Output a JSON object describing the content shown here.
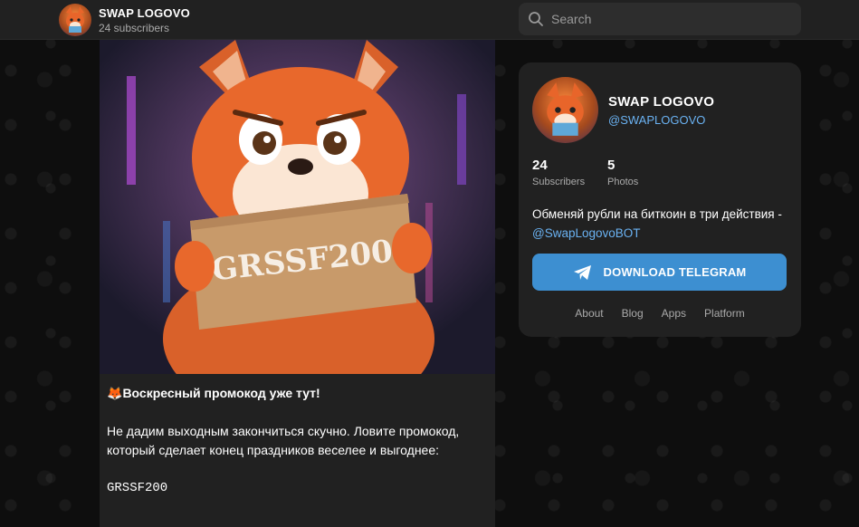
{
  "header": {
    "channel_title": "SWAP LOGOVO",
    "subscribers_text": "24 subscribers",
    "search_placeholder": "Search"
  },
  "post": {
    "image_sign_text": "GRSSF200",
    "headline_emoji": "🦊",
    "headline": "Воскресный промокод уже тут!",
    "body": "Не дадим выходным закончиться скучно. Ловите промокод, который сделает конец праздников веселее и выгоднее:",
    "code": "GRSSF200"
  },
  "card": {
    "name": "SWAP LOGOVO",
    "handle": "@SWAPLOGOVO",
    "stats": [
      {
        "value": "24",
        "label": "Subscribers"
      },
      {
        "value": "5",
        "label": "Photos"
      }
    ],
    "description_prefix": "Обменяй рубли на биткоин в три действия - ",
    "description_link": "@SwapLogovoBOT",
    "download_label": "DOWNLOAD TELEGRAM",
    "footer_links": [
      "About",
      "Blog",
      "Apps",
      "Platform"
    ]
  },
  "colors": {
    "accent_button": "#3d8fd1",
    "link": "#6ab2f2",
    "panel": "#212121",
    "background": "#0e0e0e"
  },
  "icons": {
    "search": "search-icon",
    "telegram": "telegram-plane-icon"
  }
}
